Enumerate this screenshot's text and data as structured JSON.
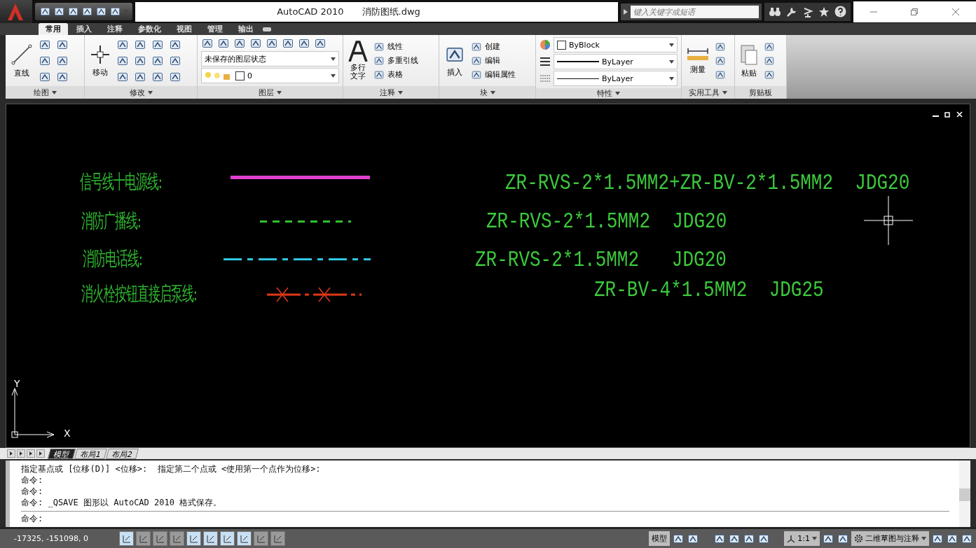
{
  "window": {
    "title": "AutoCAD 2010",
    "file_name": "消防图纸.dwg"
  },
  "search": {
    "placeholder": "键入关键字或短语"
  },
  "ribbon_tabs": [
    {
      "label": "常用",
      "selected": true
    },
    {
      "label": "插入",
      "selected": false
    },
    {
      "label": "注释",
      "selected": false
    },
    {
      "label": "参数化",
      "selected": false
    },
    {
      "label": "视图",
      "selected": false
    },
    {
      "label": "管理",
      "selected": false
    },
    {
      "label": "输出",
      "selected": false
    }
  ],
  "draw_panel": {
    "title": "绘图",
    "line_label": "直线"
  },
  "modify_panel": {
    "title": "修改",
    "move_label": "移动"
  },
  "layer_panel": {
    "title": "图层",
    "layer_state": "未保存的图层状态",
    "current_layer": "0"
  },
  "annotation_panel": {
    "title": "注释",
    "mtext_label": "多行文字",
    "linear_label": "线性",
    "mleader_label": "多重引线",
    "table_label": "表格"
  },
  "block_panel": {
    "title": "块",
    "insert_label": "插入",
    "create_label": "创建",
    "edit_label": "编辑",
    "edit_attributes_label": "编辑属性"
  },
  "properties_panel": {
    "title": "特性",
    "color_setting": "ByBlock",
    "lineweight": "ByLayer",
    "linetype": "ByLayer"
  },
  "utilities_panel": {
    "title": "实用工具",
    "measure_label": "测量"
  },
  "clipboard_panel": {
    "title": "剪贴板",
    "paste_label": "粘贴"
  },
  "legend": [
    {
      "label": "信号线十电源线:",
      "kind": "solid",
      "color": "#e040d0",
      "spec": "ZR-RVS-2*1.5MM2+ZR-BV-2*1.5MM2  JDG20"
    },
    {
      "label": "消防广播线:",
      "kind": "dashed",
      "color": "#30c030",
      "spec": "ZR-RVS-2*1.5MM2  JDG20"
    },
    {
      "label": "消防电话线:",
      "kind": "dashdot",
      "color": "#30c8e0",
      "spec": "ZR-RVS-2*1.5MM2   JDG20"
    },
    {
      "label": "消火栓按钮直接启泵线:",
      "kind": "cross",
      "color": "#e03818",
      "spec": "ZR-BV-4*1.5MM2  JDG25"
    }
  ],
  "ucs": {
    "y_label": "Y",
    "x_label": "X"
  },
  "layout_tabs": [
    {
      "label": "模型",
      "selected": true
    },
    {
      "label": "布局1",
      "selected": false
    },
    {
      "label": "布局2",
      "selected": false
    }
  ],
  "command_history": [
    "指定基点或 [位移(D)] <位移>:  指定第二个点或 <使用第一个点作为位移>:",
    "命令:",
    "命令:",
    "命令: _QSAVE 图形以 AutoCAD 2010 格式保存。"
  ],
  "command_prompt": "命令:",
  "status_bar": {
    "coordinates": "-17325, -151098, 0",
    "toggles": [
      {
        "on": true
      },
      {
        "on": false
      },
      {
        "on": false
      },
      {
        "on": false
      },
      {
        "on": true
      },
      {
        "on": true
      },
      {
        "on": true
      },
      {
        "on": true
      },
      {
        "on": false
      },
      {
        "on": false
      }
    ],
    "model_label": "模型",
    "annotation_scale": "1:1",
    "workspace": "二维草图与注释"
  }
}
